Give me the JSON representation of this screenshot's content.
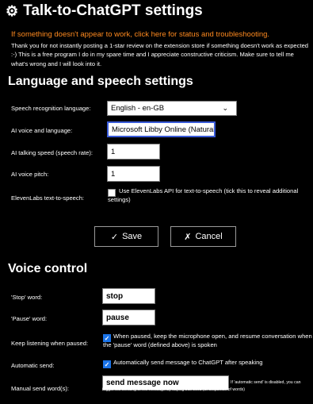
{
  "header": {
    "title": "Talk-to-ChatGPT settings",
    "status_link": "If something doesn't appear to work, click here for status and troubleshooting.",
    "intro": "Thank you for not instantly posting a 1-star review on the extension store if something doesn't work as expected :-) This is a free program I do in my spare time and I appreciate constructive criticism. Make sure to tell me what's wrong and I will look into it."
  },
  "language_section": {
    "heading": "Language and speech settings",
    "recognition_label": "Speech recognition language:",
    "recognition_value": "English - en-GB",
    "voice_label": "AI voice and language:",
    "voice_value": "Microsoft Libby Online (Natural) - E",
    "rate_label": "AI talking speed (speech rate):",
    "rate_value": "1",
    "pitch_label": "AI voice pitch:",
    "pitch_value": "1",
    "elevenlabs_label": "ElevenLabs text-to-speech:",
    "elevenlabs_checked": false,
    "elevenlabs_text": "Use ElevenLabs API for text-to-speech (tick this to reveal additional settings)"
  },
  "buttons": {
    "save_label": "Save",
    "save_icon": "✓",
    "cancel_label": "Cancel",
    "cancel_icon": "✗"
  },
  "voice_section": {
    "heading": "Voice control",
    "stop_label": "'Stop' word:",
    "stop_value": "stop",
    "pause_label": "'Pause' word:",
    "pause_value": "pause",
    "keep_label": "Keep listening when paused:",
    "keep_checked": true,
    "keep_text": "When paused, keep the microphone open, and resume conversation when the 'pause' word (defined above) is spoken",
    "autosend_label": "Automatic send:",
    "autosend_checked": true,
    "autosend_text": "Automatically send message to ChatGPT after speaking",
    "manual_label": "Manual send word(s):",
    "manual_value": "send message now",
    "manual_hint": "If 'automatic send' is disabled, you can trigger the sending of the message by saying this word (or sequence of words)"
  },
  "colors": {
    "background": "#000000",
    "link_orange": "#ff8a1f",
    "checkbox_blue": "#1a73e8",
    "focus_border": "#3a5bd8"
  },
  "icons": {
    "title_icon": "gear-icon",
    "dropdown_icon": "chevron-down-icon",
    "save_icon": "check-icon",
    "cancel_icon": "x-icon"
  }
}
